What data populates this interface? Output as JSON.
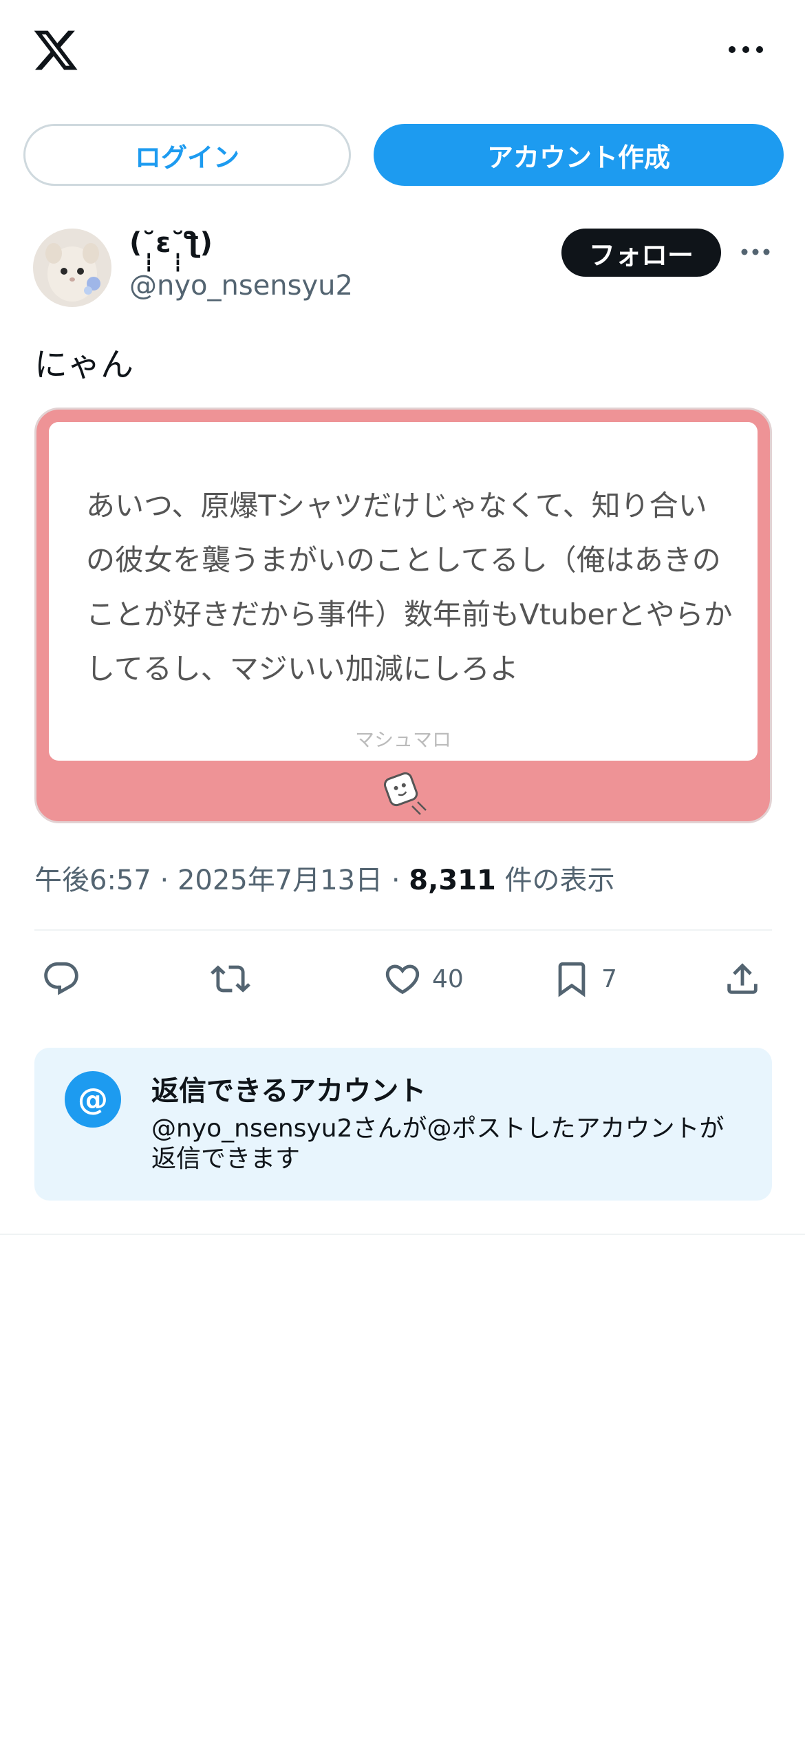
{
  "header": {
    "logo_icon": "x-logo-icon",
    "more_icon": "more-horizontal-icon"
  },
  "auth": {
    "login_label": "ログイン",
    "signup_label": "アカウント作成"
  },
  "post": {
    "display_name": "(˘̩̩̩ε˘̩̩̩ƪ)",
    "handle": "@nyo_nsensyu2",
    "follow_label": "フォロー",
    "text": "にゃん",
    "card": {
      "body": "あいつ、原爆Tシャツだけじゃなくて、知り合いの彼女を襲うまがいのことしてるし（俺はあきのことが好きだから事件）数年前もVtuberとやらかしてるし、マジいい加減にしろよ",
      "brand": "マシュマロ"
    },
    "time": "午後6:57",
    "date": "2025年7月13日",
    "views_count": "8,311",
    "views_label": "件の表示",
    "separator": "·",
    "like_count": "40",
    "bookmark_count": "7"
  },
  "reply_settings": {
    "title": "返信できるアカウント",
    "description": "@nyo_nsensyu2さんが@ポストしたアカウントが返信できます",
    "icon_glyph": "@"
  },
  "colors": {
    "accent": "#1d9bf0",
    "card_bg": "#ee9396",
    "reply_box_bg": "#e8f5fd"
  }
}
